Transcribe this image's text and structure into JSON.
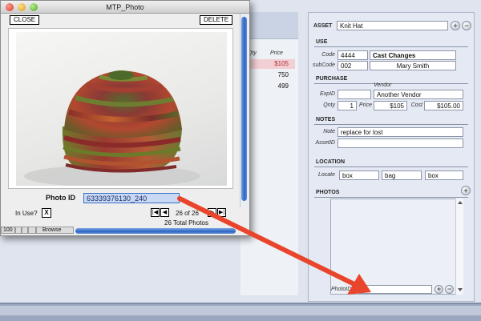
{
  "photo_window": {
    "title": "MTP_Photo",
    "close_label": "CLOSE",
    "delete_label": "DELETE",
    "photo_id_label": "Photo ID",
    "photo_id_value": "63339376130_240",
    "in_use_label": "In Use?",
    "in_use_value": "X",
    "record_position": "26 of 26",
    "total_photos": "26 Total Photos",
    "zoom": "100",
    "mode": "Browse"
  },
  "background_list": {
    "column_qty": "Qty",
    "column_price": "Price",
    "prices": [
      "$105",
      "750",
      "499"
    ]
  },
  "asset": {
    "label": "ASSET",
    "value": "Knit Hat"
  },
  "use": {
    "title": "USE",
    "code_label": "Code",
    "code_value": "4444",
    "code_name": "Cast Changes",
    "subcode_label": "subCode",
    "subcode_value": "002",
    "subcode_name": "Mary Smith"
  },
  "purchase": {
    "title": "PURCHASE",
    "vendor_label": "Vendor",
    "expid_label": "ExpID",
    "expid_value": "",
    "vendor_value": "Another Vendor",
    "qnty_label": "Qnty",
    "qnty_value": "1",
    "price_label": "Price",
    "price_value": "$105",
    "cost_label": "Cost",
    "cost_value": "$105.00"
  },
  "notes": {
    "title": "NOTES",
    "note_label": "Note",
    "note_value": "replace for lost",
    "assetid_label": "AssetID",
    "assetid_value": ""
  },
  "location": {
    "title": "LOCATION",
    "locate_label": "Locate",
    "values": [
      "box",
      "bag",
      "box"
    ]
  },
  "photos": {
    "title": "PHOTOS",
    "photoid_label": "PhotoID",
    "photoid_value": ""
  },
  "colors": {
    "arrow": "#e8452c",
    "scroll_accent": "#2f66c6"
  }
}
